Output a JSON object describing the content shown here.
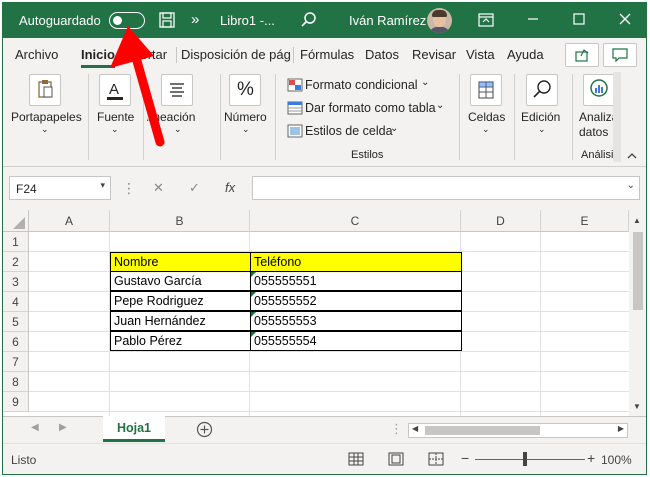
{
  "title_bar": {
    "autosave_label": "Autoguardado",
    "autosave_state": "off",
    "more_glyph": "»",
    "doc_title": "Libro1  -...",
    "user_name": "Iván Ramírez",
    "accent": "#217346"
  },
  "tabs": [
    {
      "label": "Archivo"
    },
    {
      "label": "Inicio",
      "active": true
    },
    {
      "label": "Insertar"
    },
    {
      "label": "Disposición de página"
    },
    {
      "label": "Fórmulas"
    },
    {
      "label": "Datos"
    },
    {
      "label": "Revisar"
    },
    {
      "label": "Vista"
    },
    {
      "label": "Ayuda"
    }
  ],
  "ribbon": {
    "portapapeles": "Portapapeles",
    "fuente": "Fuente",
    "alineacion": "Alineación",
    "numero": "Número",
    "numero_glyph": "%",
    "formato_condicional": "Formato condicional",
    "dar_formato": "Dar formato como tabla",
    "estilos_celda": "Estilos de celda",
    "estilos_label": "Estilos",
    "celdas": "Celdas",
    "edicion": "Edición",
    "analizar": "Analizar datos",
    "analisis_label": "Análisis"
  },
  "formula_bar": {
    "name_box": "F24",
    "fx_glyph": "fx",
    "formula": ""
  },
  "columns": [
    "A",
    "B",
    "C",
    "D",
    "E"
  ],
  "rows": [
    "1",
    "2",
    "3",
    "4",
    "5",
    "6",
    "7",
    "8",
    "9"
  ],
  "table": {
    "headers": [
      "Nombre",
      "Teléfono"
    ],
    "rows": [
      [
        "Gustavo García",
        "055555551"
      ],
      [
        "Pepe Rodriguez",
        "055555552"
      ],
      [
        "Juan Hernández",
        "055555553"
      ],
      [
        "Pablo Pérez",
        "055555554"
      ]
    ],
    "header_fill": "#ffff00"
  },
  "sheet_tab": "Hoja1",
  "status": {
    "ready": "Listo",
    "zoom": "100%"
  }
}
